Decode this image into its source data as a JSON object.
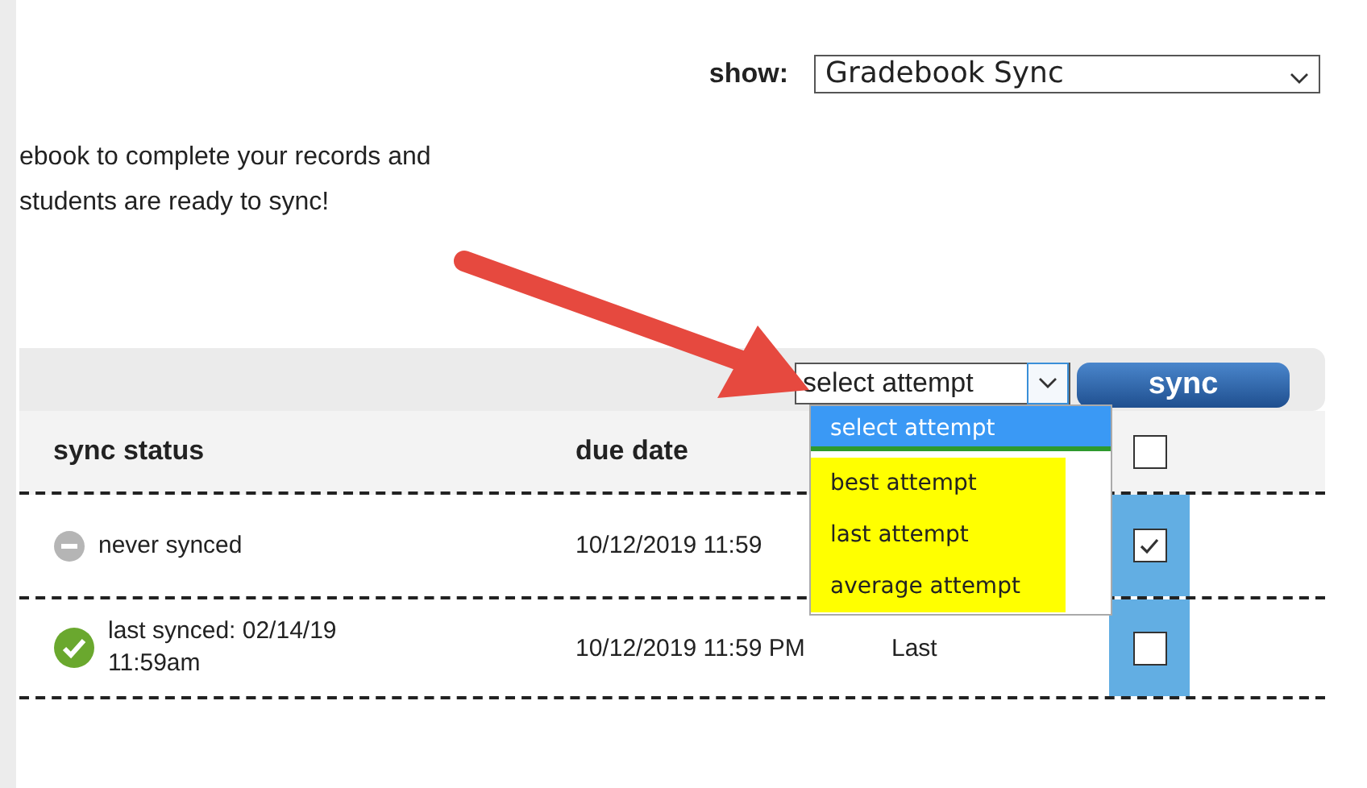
{
  "show": {
    "label": "show:",
    "value": "Gradebook Sync"
  },
  "intro": [
    "ebook to complete your records and",
    "students are ready to sync!"
  ],
  "toolbar": {
    "attempt_select": {
      "value": "select attempt",
      "open": true,
      "options": [
        {
          "label": "select attempt",
          "selected": true,
          "highlighted": false
        },
        {
          "label": "best attempt",
          "selected": false,
          "highlighted": true
        },
        {
          "label": "last attempt",
          "selected": false,
          "highlighted": true
        },
        {
          "label": "average attempt",
          "selected": false,
          "highlighted": true
        }
      ]
    },
    "sync_button": "sync"
  },
  "table": {
    "columns": [
      "sync status",
      "due date"
    ],
    "header_checked": false,
    "rows": [
      {
        "kind": "never",
        "status": "never synced",
        "due_date": "10/12/2019 11:59",
        "checked": true
      },
      {
        "kind": "synced",
        "status": "last synced: 02/14/19 11:59am",
        "due_date": "10/12/2019 11:59 PM",
        "column_3": "Last",
        "checked": false
      }
    ]
  }
}
